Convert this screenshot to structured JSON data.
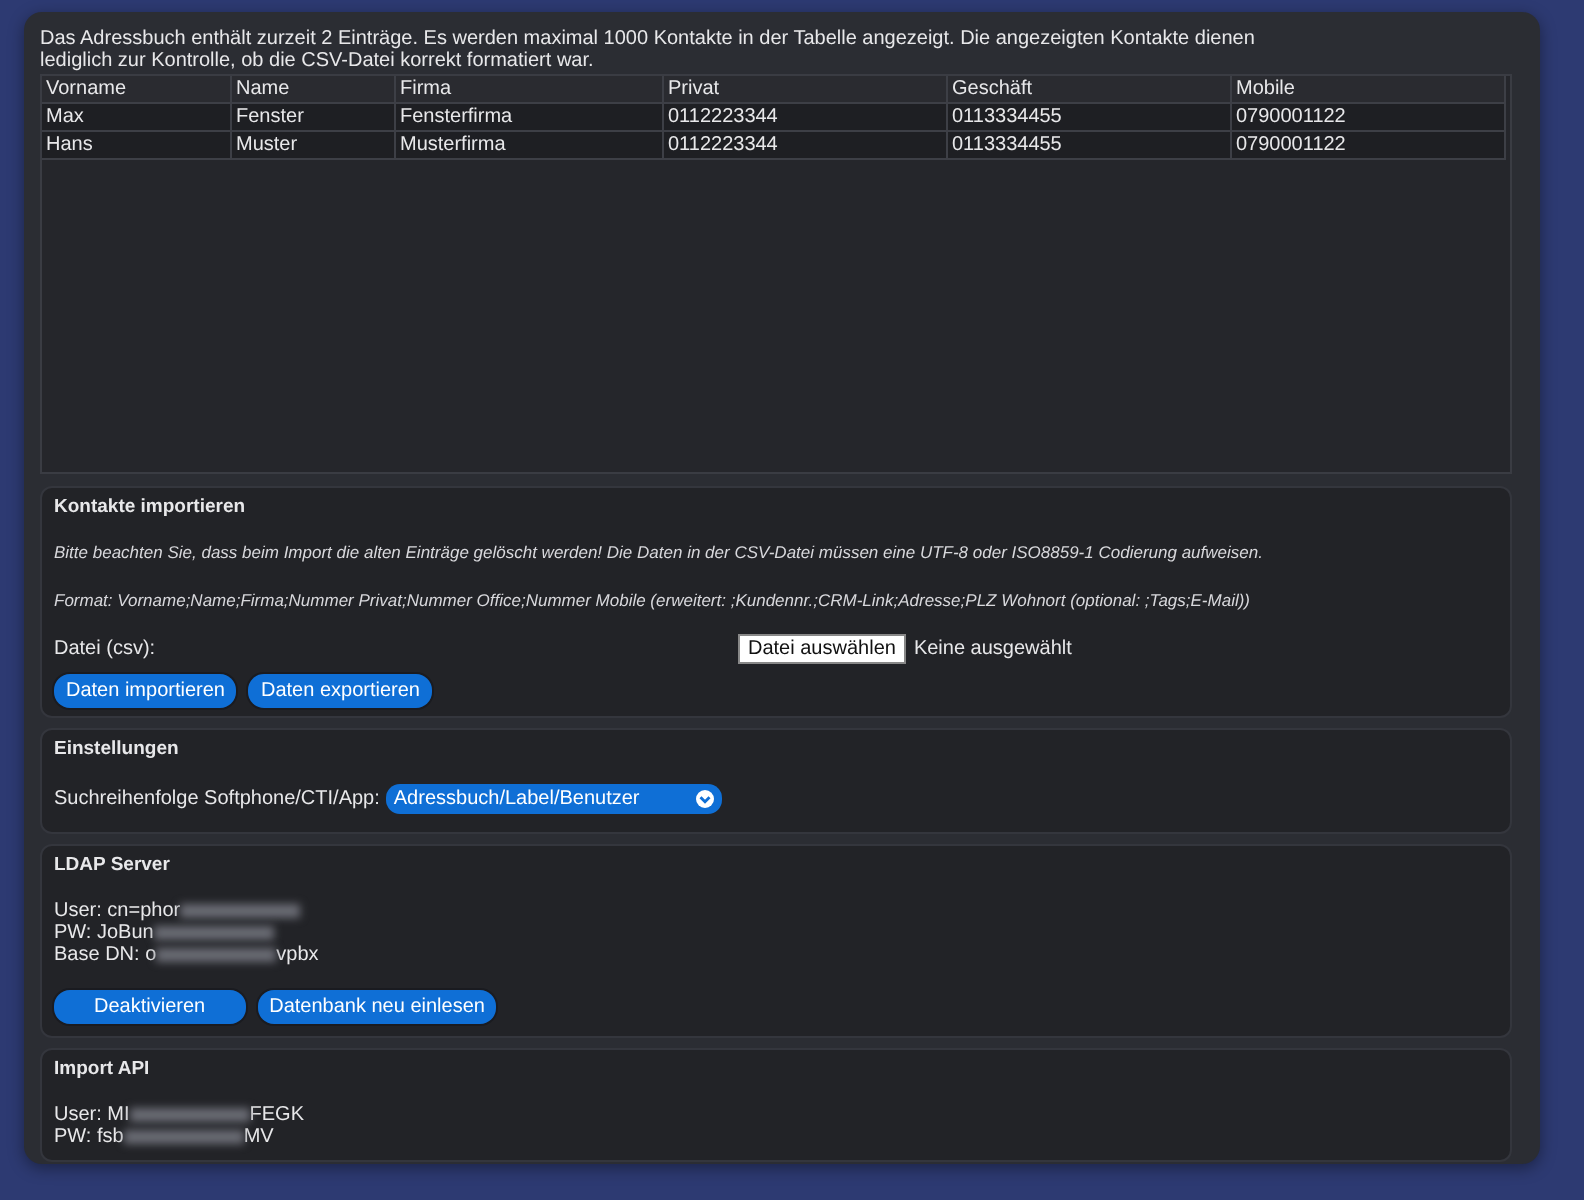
{
  "intro": "Das Adressbuch enthält zurzeit 2 Einträge. Es werden maximal 1000 Kontakte in der Tabelle angezeigt. Die angezeigten Kontakte dienen lediglich zur Kontrolle, ob die CSV-Datei korrekt formatiert war.",
  "table": {
    "columns": [
      "Vorname",
      "Name",
      "Firma",
      "Privat",
      "Geschäft",
      "Mobile"
    ],
    "rows": [
      [
        "Max",
        "Fenster",
        "Fensterfirma",
        "0112223344",
        "0113334455",
        "0790001122"
      ],
      [
        "Hans",
        "Muster",
        "Musterfirma",
        "0112223344",
        "0113334455",
        "0790001122"
      ]
    ]
  },
  "import": {
    "title": "Kontakte importieren",
    "notice": "Bitte beachten Sie, dass beim Import die alten Einträge gelöscht werden! Die Daten in der CSV-Datei müssen eine UTF-8 oder ISO8859-1 Codierung aufweisen.",
    "format": "Format: Vorname;Name;Firma;Nummer Privat;Nummer Office;Nummer Mobile (erweitert: ;Kundennr.;CRM-Link;Adresse;PLZ Wohnort (optional: ;Tags;E-Mail))",
    "file_label": "Datei (csv):",
    "file_button": "Datei auswählen",
    "file_status": "Keine ausgewählt",
    "buttons": [
      "Daten importieren",
      "Daten exportieren"
    ]
  },
  "settings": {
    "title": "Einstellungen",
    "label": "Suchreihenfolge Softphone/CTI/App:",
    "value": "Adressbuch/Label/Benutzer"
  },
  "ldap": {
    "title": "LDAP Server",
    "lines": [
      {
        "start": "User: cn=phor"
      },
      {
        "start": "PW: JoBun"
      },
      {
        "start": "Base DN: o",
        "end": "vpbx"
      }
    ],
    "buttons": [
      "Deaktivieren",
      "Datenbank neu einlesen"
    ]
  },
  "api": {
    "title": "Import API",
    "lines": [
      {
        "start": "User: MI",
        "end": "FEGK"
      },
      {
        "start": "PW: fsb",
        "end": "MV"
      }
    ]
  }
}
